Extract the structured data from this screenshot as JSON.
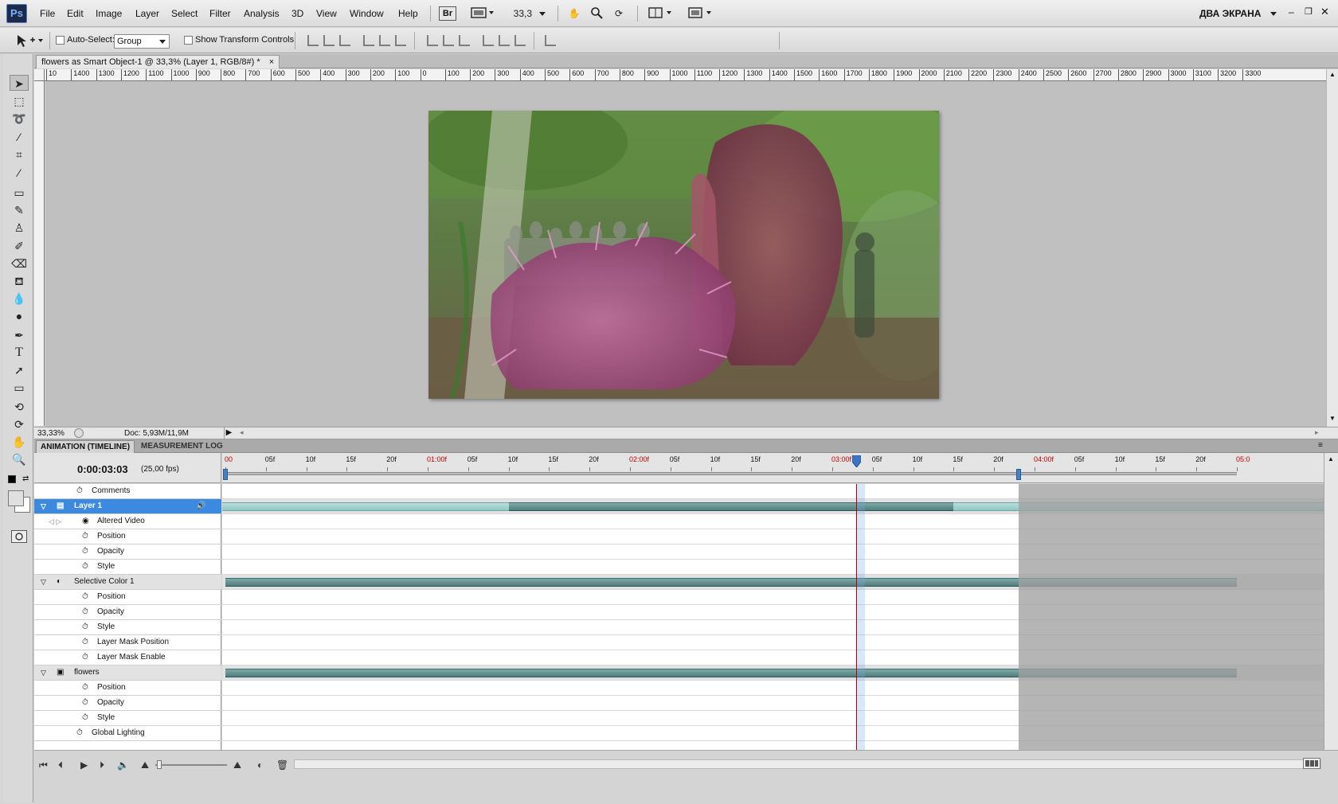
{
  "app": {
    "logo": "Ps",
    "workspace": "ДВА ЭКРАНА"
  },
  "menu": [
    "File",
    "Edit",
    "Image",
    "Layer",
    "Select",
    "Filter",
    "Analysis",
    "3D",
    "View",
    "Window",
    "Help"
  ],
  "menubar": {
    "bridge": "Br",
    "zoom": "33,3"
  },
  "options": {
    "auto_select_label": "Auto-Select:",
    "auto_select_value": "Group",
    "show_transform_label": "Show Transform Controls"
  },
  "document": {
    "tab_title": "flowers as Smart Object-1 @ 33,3% (Layer 1, RGB/8#) *",
    "close": "×",
    "zoom_status": "33,33%",
    "doc_info": "Doc: 5,93M/11,9M"
  },
  "ruler_labels": [
    "10",
    "1400",
    "1300",
    "1200",
    "1100",
    "1000",
    "900",
    "800",
    "700",
    "600",
    "500",
    "400",
    "300",
    "200",
    "100",
    "0",
    "100",
    "200",
    "300",
    "400",
    "500",
    "600",
    "700",
    "800",
    "900",
    "1000",
    "1100",
    "1200",
    "1300",
    "1400",
    "1500",
    "1600",
    "1700",
    "1800",
    "1900",
    "2000",
    "2100",
    "2200",
    "2300",
    "2400",
    "2500",
    "2600",
    "2700",
    "2800",
    "2900",
    "3000",
    "3100",
    "3200",
    "3300"
  ],
  "timeline": {
    "tabs": [
      "ANIMATION (TIMELINE)",
      "MEASUREMENT LOG"
    ],
    "timecode": "0:00:03:03",
    "fps": "(25,00 fps)",
    "time_labels": [
      "00",
      "05f",
      "10f",
      "15f",
      "20f",
      "01:00f",
      "05f",
      "10f",
      "15f",
      "20f",
      "02:00f",
      "05f",
      "10f",
      "15f",
      "20f",
      "03:00f",
      "05f",
      "10f",
      "15f",
      "20f",
      "04:00f",
      "05f",
      "10f",
      "15f",
      "20f",
      "05:0"
    ],
    "second_marker_color": "#c00000",
    "playhead_frames": 78,
    "work_area_end_frames": 98,
    "total_frames": 125,
    "rows": [
      {
        "label": "Comments",
        "type": "prop",
        "indent": 1
      },
      {
        "label": "Layer 1",
        "type": "layer",
        "selected": true,
        "icon": "film-icon"
      },
      {
        "label": "Altered Video",
        "type": "prop",
        "indent": 2,
        "icon": "eye-icon"
      },
      {
        "label": "Position",
        "type": "prop",
        "indent": 2
      },
      {
        "label": "Opacity",
        "type": "prop",
        "indent": 2
      },
      {
        "label": "Style",
        "type": "prop",
        "indent": 2
      },
      {
        "label": "Selective Color 1",
        "type": "layer",
        "icon": "adjustment-icon"
      },
      {
        "label": "Position",
        "type": "prop",
        "indent": 2
      },
      {
        "label": "Opacity",
        "type": "prop",
        "indent": 2
      },
      {
        "label": "Style",
        "type": "prop",
        "indent": 2
      },
      {
        "label": "Layer Mask Position",
        "type": "prop",
        "indent": 2
      },
      {
        "label": "Layer Mask Enable",
        "type": "prop",
        "indent": 2
      },
      {
        "label": "flowers",
        "type": "layer",
        "icon": "smart-object-icon"
      },
      {
        "label": "Position",
        "type": "prop",
        "indent": 2
      },
      {
        "label": "Opacity",
        "type": "prop",
        "indent": 2
      },
      {
        "label": "Style",
        "type": "prop",
        "indent": 2
      },
      {
        "label": "Global Lighting",
        "type": "prop",
        "indent": 1
      }
    ],
    "clips": {
      "layer1_light": [
        0,
        125
      ],
      "layer1_dark": [
        35,
        90
      ],
      "selective_color": [
        0,
        125
      ],
      "flowers": [
        0,
        125
      ]
    }
  },
  "colors": {
    "accent": "#3b8ae0",
    "clip": "#5e8e8d",
    "clip_light": "#a7d2d0",
    "playhead": "#b00000"
  }
}
